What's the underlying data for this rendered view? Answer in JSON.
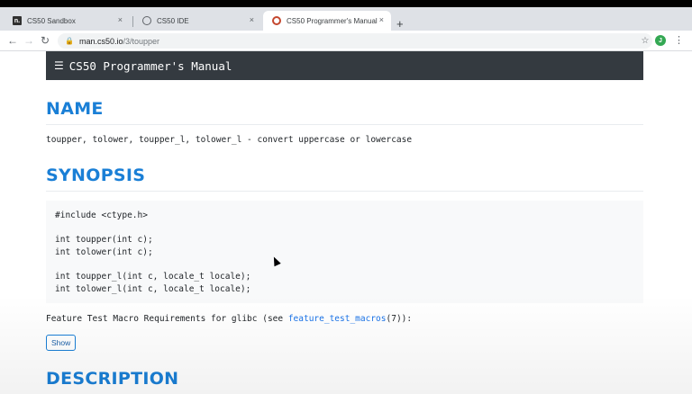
{
  "browser": {
    "tabs": [
      {
        "label": "CS50 Sandbox",
        "icon": "cs50-sandbox-icon"
      },
      {
        "label": "CS50 IDE",
        "icon": "globe-icon"
      },
      {
        "label": "CS50 Programmer's Manual",
        "icon": "cs50-manual-icon"
      }
    ],
    "new_tab_glyph": "+",
    "close_glyph": "×",
    "url_host": "man.cs50.io",
    "url_path": "/3/toupper",
    "profile_initial": "J"
  },
  "page": {
    "brand": "CS50 Programmer's Manual",
    "sections": {
      "name_heading": "NAME",
      "synopsis_heading": "SYNOPSIS",
      "description_heading": "DESCRIPTION"
    },
    "name_line": "toupper, tolower, toupper_l, tolower_l - convert uppercase or lowercase",
    "code": {
      "include": "#include <ctype.h>",
      "l1": "int toupper(int c);",
      "l2": "int tolower(int c);",
      "l3": "int toupper_l(int c, locale_t locale);",
      "l4": "int tolower_l(int c, locale_t locale);"
    },
    "ftm_prefix": "Feature Test Macro Requirements for glibc (see ",
    "ftm_link": "feature_test_macros",
    "ftm_suffix": "(7)):",
    "show_label": "Show"
  }
}
